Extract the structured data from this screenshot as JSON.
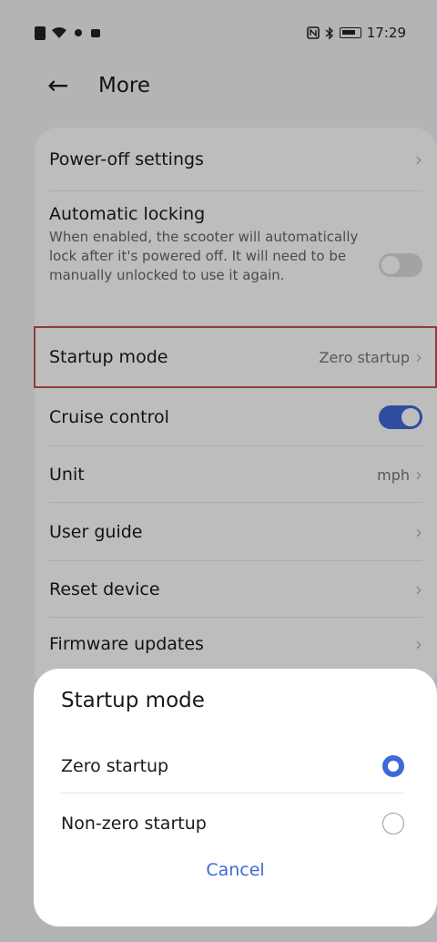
{
  "status_bar": {
    "time": "17:29",
    "left_icons": [
      "sim-icon",
      "wifi-icon",
      "bluetooth-dot-icon",
      "notification-icon"
    ],
    "right_icons": [
      "nfc-icon",
      "bluetooth-icon",
      "battery-icon"
    ]
  },
  "header": {
    "title": "More",
    "back_glyph": "←"
  },
  "settings": {
    "power_off": {
      "label": "Power-off settings"
    },
    "auto_lock": {
      "label": "Automatic locking",
      "description": "When enabled, the scooter will automatically lock after it's powered off. It will need to be manually unlocked to use it again.",
      "enabled": false
    },
    "startup_mode": {
      "label": "Startup mode",
      "value": "Zero startup"
    },
    "cruise_control": {
      "label": "Cruise control",
      "enabled": true
    },
    "unit": {
      "label": "Unit",
      "value": "mph"
    },
    "user_guide": {
      "label": "User guide"
    },
    "reset_device": {
      "label": "Reset device"
    },
    "firmware_updates": {
      "label": "Firmware updates"
    },
    "chevron": "›"
  },
  "sheet": {
    "title": "Startup mode",
    "options": [
      {
        "label": "Zero startup",
        "selected": true
      },
      {
        "label": "Non-zero startup",
        "selected": false
      }
    ],
    "cancel_label": "Cancel"
  },
  "colors": {
    "accent": "#3e69d8",
    "highlight_border": "#c4524a"
  }
}
